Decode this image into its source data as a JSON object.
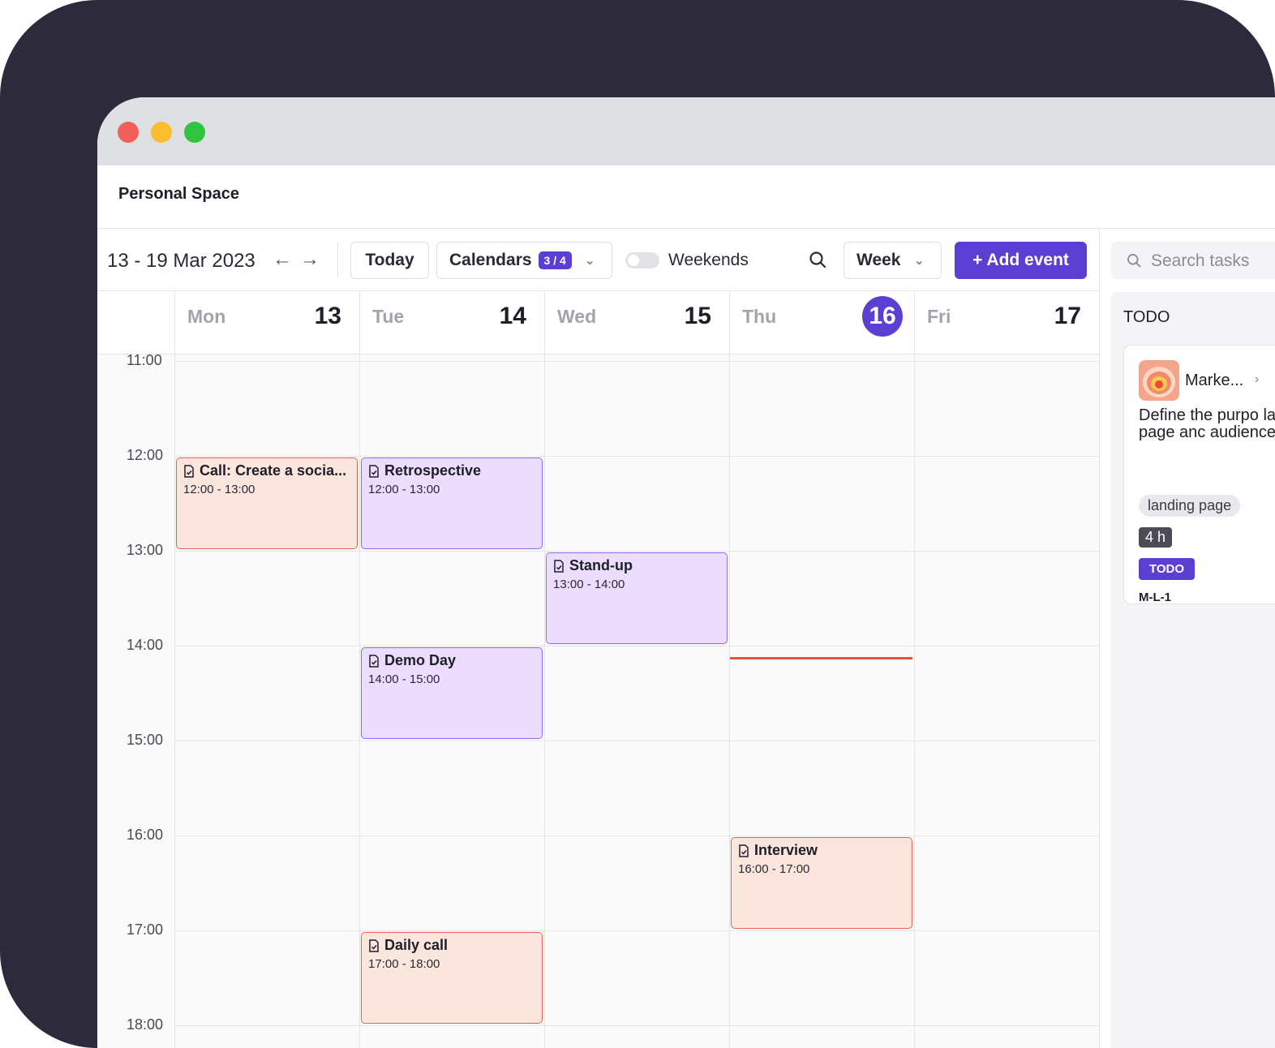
{
  "app": {
    "title": "Personal Space"
  },
  "toolbar": {
    "range": "13 - 19 Mar 2023",
    "prev_icon": "arrow-left-icon",
    "next_icon": "arrow-right-icon",
    "today_label": "Today",
    "calendars_label": "Calendars",
    "calendars_badge": "3 / 4",
    "weekends_label": "Weekends",
    "weekends_enabled": false,
    "view_label": "Week",
    "add_event_label": "+ Add event"
  },
  "days": [
    {
      "name": "Mon",
      "num": "13",
      "today": false
    },
    {
      "name": "Tue",
      "num": "14",
      "today": false
    },
    {
      "name": "Wed",
      "num": "15",
      "today": false
    },
    {
      "name": "Thu",
      "num": "16",
      "today": true
    },
    {
      "name": "Fri",
      "num": "17",
      "today": false
    }
  ],
  "hours": [
    "11:00",
    "12:00",
    "13:00",
    "14:00",
    "15:00",
    "16:00",
    "17:00",
    "18:00"
  ],
  "events": [
    {
      "title": "Call: Create a socia...",
      "time": "12:00 - 13:00",
      "day": 0,
      "start": 12,
      "end": 13,
      "color": "orange"
    },
    {
      "title": "Retrospective",
      "time": "12:00 - 13:00",
      "day": 1,
      "start": 12,
      "end": 13,
      "color": "purple"
    },
    {
      "title": "Stand-up",
      "time": "13:00 - 14:00",
      "day": 2,
      "start": 13,
      "end": 14,
      "color": "purple"
    },
    {
      "title": "Demo Day",
      "time": "14:00 - 15:00",
      "day": 1,
      "start": 14,
      "end": 15,
      "color": "purple"
    },
    {
      "title": "Interview",
      "time": "16:00 - 17:00",
      "day": 3,
      "start": 16,
      "end": 17,
      "color": "orange"
    },
    {
      "title": "Daily call",
      "time": "17:00 - 18:00",
      "day": 1,
      "start": 17,
      "end": 18,
      "color": "orange"
    }
  ],
  "sidebar": {
    "search_placeholder": "Search tasks",
    "column_title": "TODO",
    "card": {
      "project": "Marke...",
      "description": "Define the purpo landing page anc audience.",
      "tag": "landing page",
      "estimate": "4 h",
      "status": "TODO",
      "code": "M-L-1"
    }
  },
  "colors": {
    "accent": "#5b3ed2",
    "now_line": "#e05a3a",
    "event_orange_bg": "#fae6dc",
    "event_orange_border": "#e46451",
    "event_purple_bg": "#ecdcfd",
    "event_purple_border": "#8f6ae6"
  }
}
